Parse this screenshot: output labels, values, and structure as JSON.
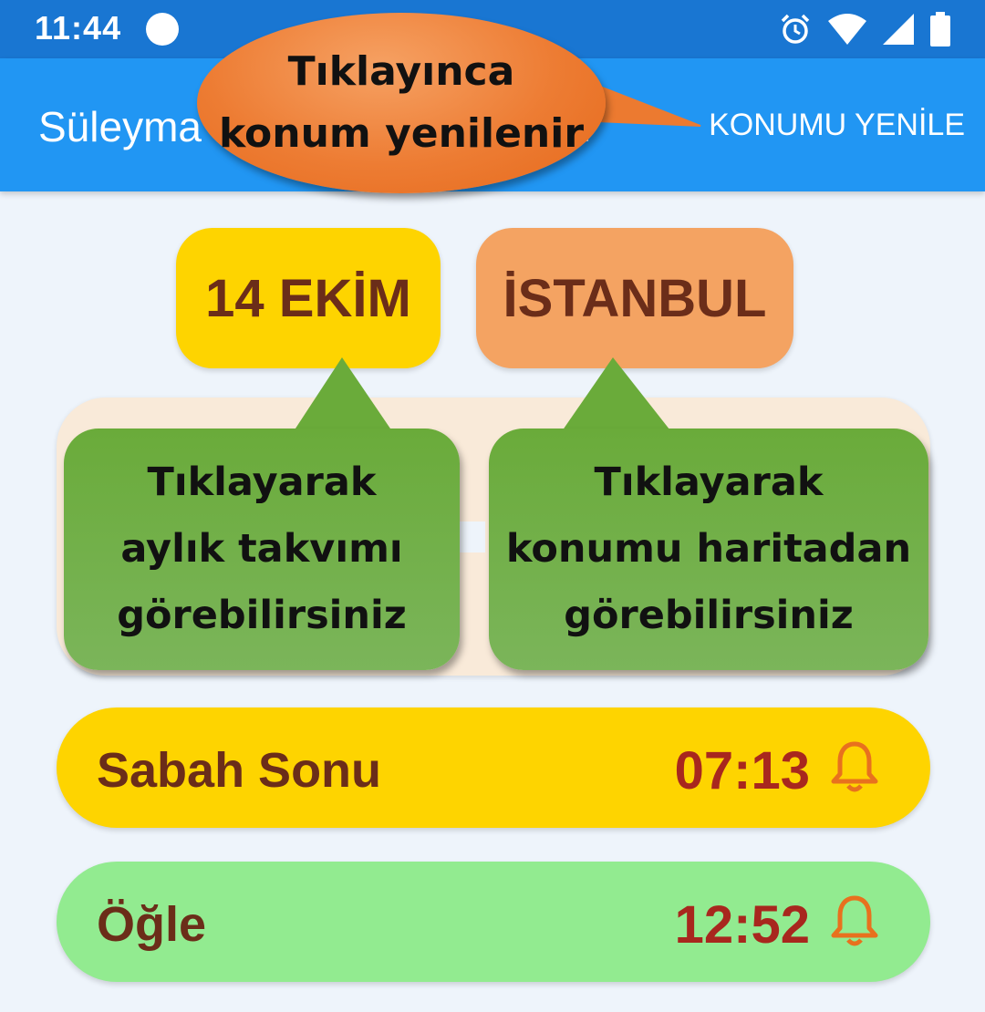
{
  "status_bar": {
    "time": "11:44",
    "icons": [
      "cloud-icon",
      "alarm-icon",
      "wifi-icon",
      "signal-icon",
      "battery-icon"
    ]
  },
  "app_bar": {
    "title": "Süleyma",
    "title_tail": "...",
    "action_label": "KONUMU YENİLE"
  },
  "callouts": {
    "refresh": [
      "Tıklayınca",
      "konum yenilenir"
    ],
    "calendar": [
      "Tıklayarak",
      "aylık takvımı",
      "görebilirsiniz"
    ],
    "map": [
      "Tıklayarak",
      "konumu haritadan",
      "görebilirsiniz"
    ]
  },
  "chips": {
    "date": "14 EKİM",
    "city": "İSTANBUL"
  },
  "prayers": [
    {
      "name": "Sabah Sonu",
      "time": "07:13",
      "color": "#fed400"
    },
    {
      "name": "Öğle",
      "time": "12:52",
      "color": "#92eb90"
    }
  ],
  "colors": {
    "appbar": "#2196f3",
    "statusbar": "#1976d2",
    "label_brown": "#6b2d19",
    "time_red": "#a8271e",
    "bell_orange": "#e8711e"
  }
}
